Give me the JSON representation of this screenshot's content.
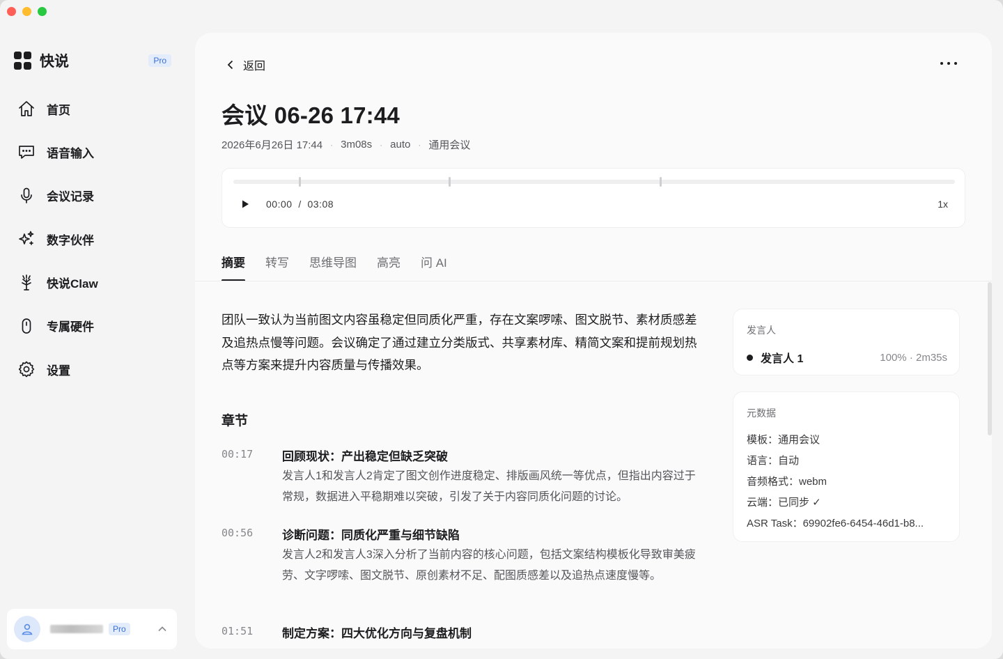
{
  "app": {
    "name": "快说",
    "pro_badge": "Pro"
  },
  "sidebar": {
    "items": [
      {
        "label": "首页",
        "icon": "home-icon"
      },
      {
        "label": "语音输入",
        "icon": "chat-bubble-icon"
      },
      {
        "label": "会议记录",
        "icon": "microphone-icon"
      },
      {
        "label": "数字伙伴",
        "icon": "sparkles-icon"
      },
      {
        "label": "快说Claw",
        "icon": "claw-icon"
      },
      {
        "label": "专属硬件",
        "icon": "device-icon"
      },
      {
        "label": "设置",
        "icon": "gear-icon"
      }
    ],
    "user": {
      "pro_badge": "Pro"
    }
  },
  "header": {
    "back_label": "返回"
  },
  "meeting": {
    "title": "会议 06-26 17:44",
    "date": "2026年6月26日 17:44",
    "duration": "3m08s",
    "language": "auto",
    "template": "通用会议"
  },
  "player": {
    "current": "00:00",
    "separator": "/",
    "total": "03:08",
    "speed": "1x",
    "progress": 0,
    "chapter_markers_seconds": [
      17,
      56,
      111
    ],
    "total_seconds": 188
  },
  "tabs": [
    "摘要",
    "转写",
    "思维导图",
    "高亮",
    "问 AI"
  ],
  "active_tab": 0,
  "summary": "团队一致认为当前图文内容虽稳定但同质化严重，存在文案啰嗦、图文脱节、素材质感差及追热点慢等问题。会议确定了通过建立分类版式、共享素材库、精简文案和提前规划热点等方案来提升内容质量与传播效果。",
  "chapters_title": "章节",
  "chapters": [
    {
      "time": "00:17",
      "title": "回顾现状：产出稳定但缺乏突破",
      "desc": "发言人1和发言人2肯定了图文创作进度稳定、排版画风统一等优点，但指出内容过于常规，数据进入平稳期难以突破，引发了关于内容同质化问题的讨论。"
    },
    {
      "time": "00:56",
      "title": "诊断问题：同质化严重与细节缺陷",
      "desc": "发言人2和发言人3深入分析了当前内容的核心问题，包括文案结构模板化导致审美疲劳、文字啰嗦、图文脱节、原创素材不足、配图质感差以及追热点速度慢等。"
    },
    {
      "time": "01:51",
      "title": "制定方案：四大优化方向与复盘机制",
      "desc": ""
    }
  ],
  "speakers_card": {
    "label": "发言人",
    "speakers": [
      {
        "name": "发言人 1",
        "stat": "100% · 2m35s"
      }
    ]
  },
  "metadata_card": {
    "label": "元数据",
    "rows": [
      "模板：通用会议",
      "语言：自动",
      "音频格式：webm",
      "云端：已同步 ✓",
      "ASR Task：69902fe6-6454-46d1-b8..."
    ]
  }
}
